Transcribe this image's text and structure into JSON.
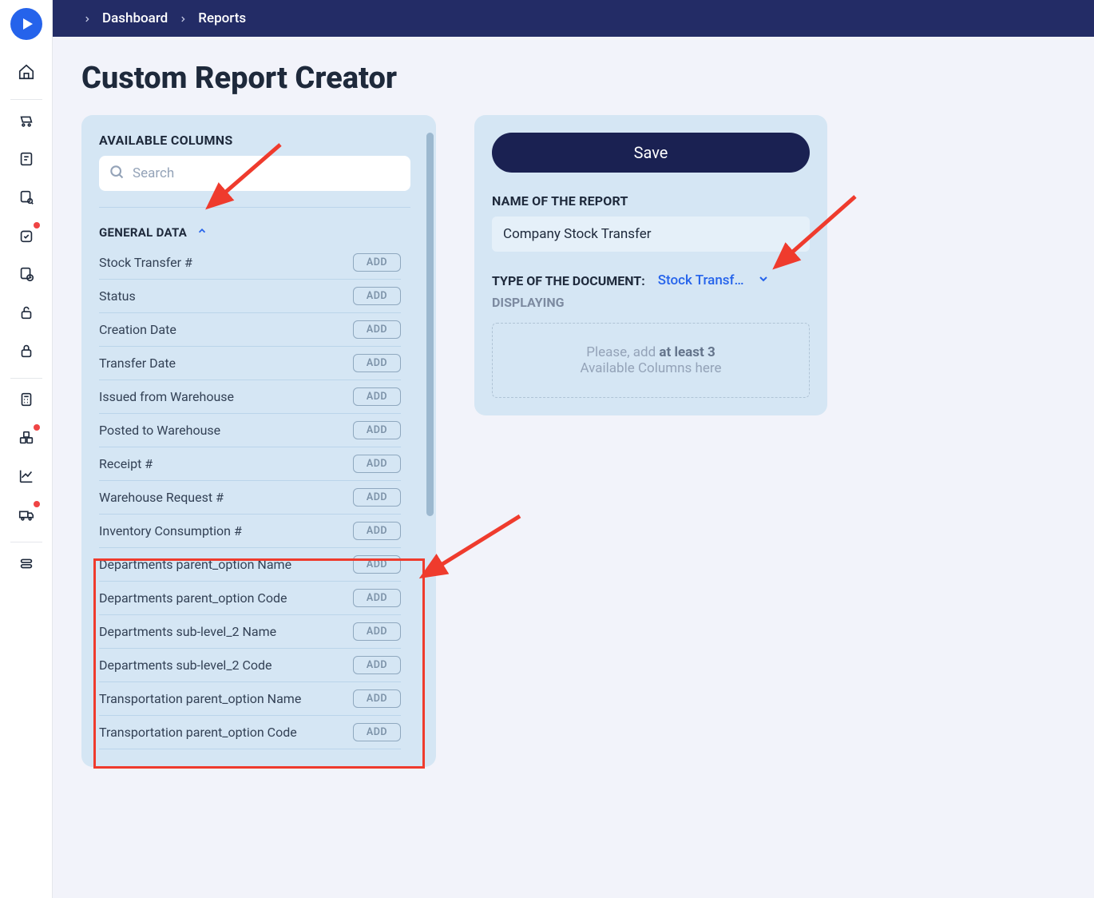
{
  "breadcrumbs": {
    "item1": "Dashboard",
    "item2": "Reports"
  },
  "page": {
    "title": "Custom Report Creator"
  },
  "available": {
    "header": "AVAILABLE COLUMNS",
    "search_placeholder": "Search",
    "group_title": "GENERAL DATA",
    "add_label": "ADD",
    "items": [
      "Stock Transfer #",
      "Status",
      "Creation Date",
      "Transfer Date",
      "Issued from Warehouse",
      "Posted to Warehouse",
      "Receipt #",
      "Warehouse Request #",
      "Inventory Consumption #",
      "Departments parent_option Name",
      "Departments parent_option Code",
      "Departments sub-level_2 Name",
      "Departments sub-level_2 Code",
      "Transportation parent_option Name",
      "Transportation parent_option Code"
    ]
  },
  "right": {
    "save_label": "Save",
    "name_label": "NAME OF THE REPORT",
    "name_value": "Company Stock Transfer",
    "type_label": "TYPE OF THE DOCUMENT:",
    "type_value": "Stock Transf…",
    "displaying_label": "DISPLAYING",
    "drop_prefix": "Please, add ",
    "drop_bold": "at least 3",
    "drop_line2": "Available Columns here"
  }
}
